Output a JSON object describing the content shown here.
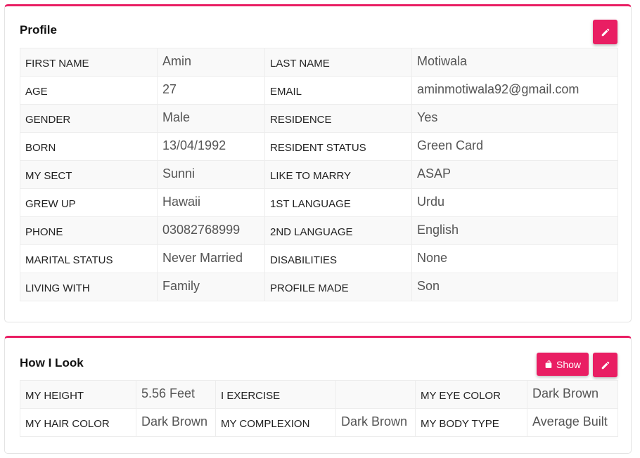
{
  "profile": {
    "title": "Profile",
    "rows": [
      [
        {
          "label": "FIRST NAME",
          "value": "Amin"
        },
        {
          "label": "LAST NAME",
          "value": "Motiwala"
        }
      ],
      [
        {
          "label": "AGE",
          "value": "27"
        },
        {
          "label": "EMAIL",
          "value": "aminmotiwala92@gmail.com"
        }
      ],
      [
        {
          "label": "GENDER",
          "value": "Male"
        },
        {
          "label": "RESIDENCE",
          "value": "Yes"
        }
      ],
      [
        {
          "label": "BORN",
          "value": "13/04/1992"
        },
        {
          "label": "RESIDENT STATUS",
          "value": "Green Card"
        }
      ],
      [
        {
          "label": "MY SECT",
          "value": "Sunni"
        },
        {
          "label": "LIKE TO MARRY",
          "value": "ASAP"
        }
      ],
      [
        {
          "label": "GREW UP",
          "value": "Hawaii"
        },
        {
          "label": "1ST LANGUAGE",
          "value": "Urdu"
        }
      ],
      [
        {
          "label": "PHONE",
          "value": "03082768999"
        },
        {
          "label": "2ND LANGUAGE",
          "value": "English"
        }
      ],
      [
        {
          "label": "MARITAL STATUS",
          "value": "Never Married"
        },
        {
          "label": "DISABILITIES",
          "value": "None"
        }
      ],
      [
        {
          "label": "LIVING WITH",
          "value": "Family"
        },
        {
          "label": "PROFILE MADE",
          "value": "Son"
        }
      ]
    ],
    "edit_icon": "pencil-icon"
  },
  "look": {
    "title": "How I Look",
    "show_label": "Show",
    "show_icon": "unlock-icon",
    "edit_icon": "pencil-icon",
    "rows": [
      [
        {
          "label": "MY HEIGHT",
          "value": "5.56 Feet"
        },
        {
          "label": "I EXERCISE",
          "value": ""
        },
        {
          "label": "MY EYE COLOR",
          "value": "Dark Brown"
        }
      ],
      [
        {
          "label": "MY HAIR COLOR",
          "value": "Dark Brown"
        },
        {
          "label": "MY COMPLEXION",
          "value": "Dark Brown"
        },
        {
          "label": "MY BODY TYPE",
          "value": "Average Built"
        }
      ]
    ]
  },
  "colors": {
    "accent": "#e91e63",
    "label_text": "#222222",
    "value_text": "#555555",
    "striped_row": "#f9f9f9"
  }
}
